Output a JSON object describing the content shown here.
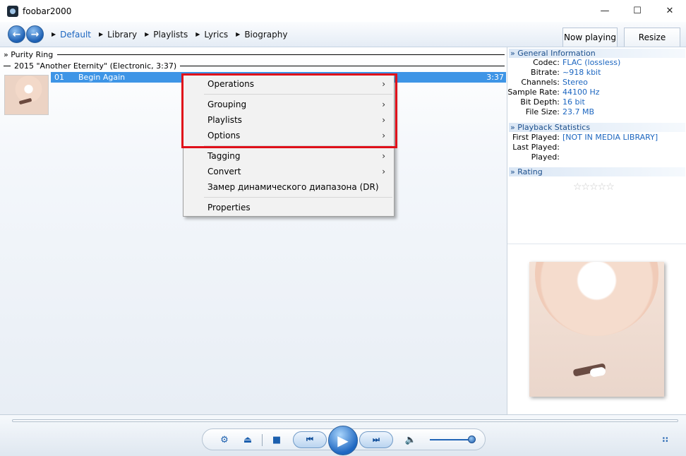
{
  "window": {
    "title": "foobar2000",
    "controls": {
      "minimize": "—",
      "maximize": "☐",
      "close": "✕"
    }
  },
  "nav": {
    "back": "←",
    "forward": "→",
    "breadcrumbs": [
      "Default",
      "Library",
      "Playlists",
      "Lyrics",
      "Biography"
    ],
    "tabs": [
      "Now playing",
      "Resize"
    ]
  },
  "playlist": {
    "group_artist": "» Purity Ring",
    "group_album": "2015 \"Another Eternity\" (Electronic, 3:37)",
    "track": {
      "number": "01",
      "title": "Begin Again",
      "duration": "3:37"
    }
  },
  "context_menu": {
    "items": [
      "Operations",
      "Grouping",
      "Playlists",
      "Options",
      "Tagging",
      "Convert",
      "Замер динамического диапазона (DR)",
      "Properties"
    ],
    "submenu_arrow": "›"
  },
  "info": {
    "general": {
      "header": "» General Information",
      "rows": [
        {
          "k": "Codec:",
          "v": "FLAC (lossless)"
        },
        {
          "k": "Bitrate:",
          "v": "~918 kbit"
        },
        {
          "k": "Channels:",
          "v": "Stereo"
        },
        {
          "k": "Sample Rate:",
          "v": "44100 Hz"
        },
        {
          "k": "Bit Depth:",
          "v": "16 bit"
        },
        {
          "k": "File Size:",
          "v": "23.7  MB"
        }
      ]
    },
    "stats": {
      "header": "» Playback Statistics",
      "rows": [
        {
          "k": "First Played:",
          "v": "[NOT IN MEDIA LIBRARY]"
        },
        {
          "k": "Last Played:",
          "v": ""
        },
        {
          "k": "Played:",
          "v": ""
        }
      ]
    },
    "rating": {
      "header": "» Rating",
      "stars": "☆☆☆☆☆",
      "value": 0,
      "max": 5
    }
  },
  "player": {
    "settings_icon": "⚙",
    "eject_icon": "⏏",
    "stop_icon": "■",
    "prev_icon": "⏮",
    "play_icon": "▶",
    "next_icon": "⏭",
    "volume_icon": "🔈",
    "layout_icon": "⠶",
    "volume_level": 1.0
  },
  "colors": {
    "accent": "#1c66c0",
    "selection": "#3e95e6",
    "highlight_border": "#e0101a"
  }
}
